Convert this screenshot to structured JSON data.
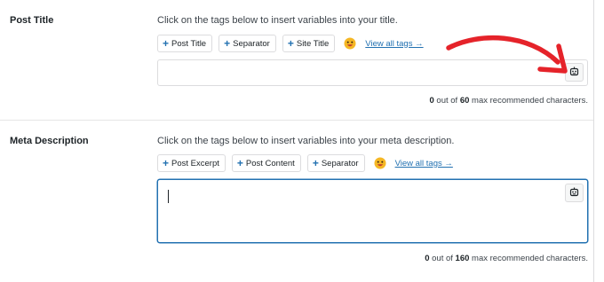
{
  "post_title": {
    "label": "Post Title",
    "instruction": "Click on the tags below to insert variables into your title.",
    "tags": [
      "Post Title",
      "Separator",
      "Site Title"
    ],
    "view_all": "View all tags →",
    "value": "",
    "counter": {
      "count": "0",
      "middle": " out of ",
      "max": "60",
      "suffix": " max recommended characters."
    }
  },
  "meta_description": {
    "label": "Meta Description",
    "instruction": "Click on the tags below to insert variables into your meta description.",
    "tags": [
      "Post Excerpt",
      "Post Content",
      "Separator"
    ],
    "view_all": "View all tags →",
    "value": "",
    "counter": {
      "count": "0",
      "middle": " out of ",
      "max": "160",
      "suffix": " max recommended characters."
    }
  },
  "icons": {
    "tag_add": "plus-icon",
    "emoji": "emoji-icon",
    "smart_tags": "smart-tags-icon",
    "annotation": "red-arrow-annotation"
  },
  "colors": {
    "accent": "#2271b1",
    "annotation": "#e5232a",
    "border": "#dcdcde"
  }
}
